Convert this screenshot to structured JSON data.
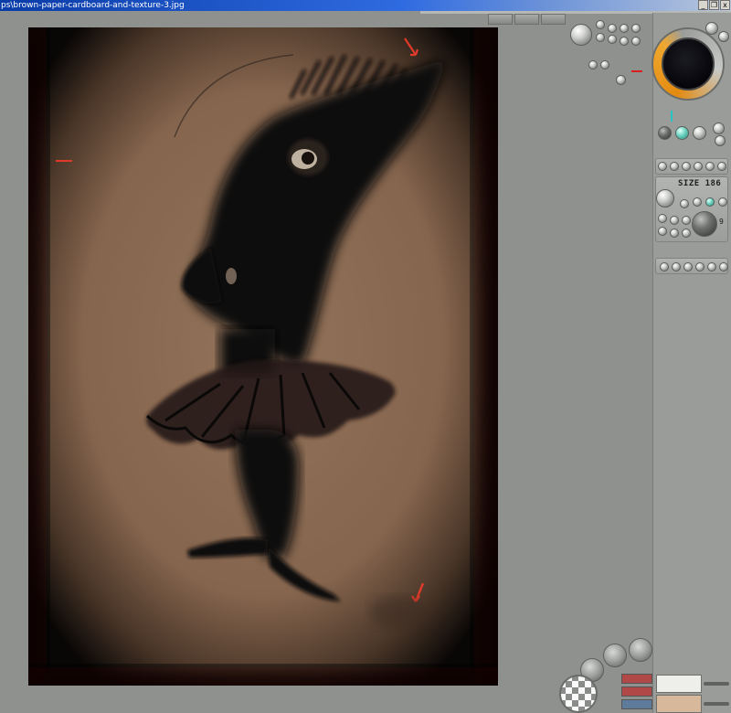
{
  "window": {
    "title": "ps\\brown-paper-cardboard-and-texture-3.jpg",
    "minimize_glyph": "_",
    "restore_glyph": "❐",
    "close_glyph": "x"
  },
  "tabs": [
    "",
    "",
    ""
  ],
  "canvas": {
    "paper_color": "#8b6a52",
    "ink_color": "#0b0908",
    "marker_color": "#e03a2a",
    "icon": "brown-paper-charcoal-drawing"
  },
  "brush_panel": {
    "size_label": "SIZE 186",
    "value_readout": "9",
    "accent_colors": {
      "dial_orange": "#e38a10",
      "marker_red": "#d82020",
      "marker_teal": "#25c5c6"
    }
  },
  "tray": {
    "swatch_colors": [
      "#b04848",
      "#b04848",
      "#5f7b9b"
    ],
    "layer_thumbs": [
      "layer-1",
      "layer-2"
    ]
  }
}
